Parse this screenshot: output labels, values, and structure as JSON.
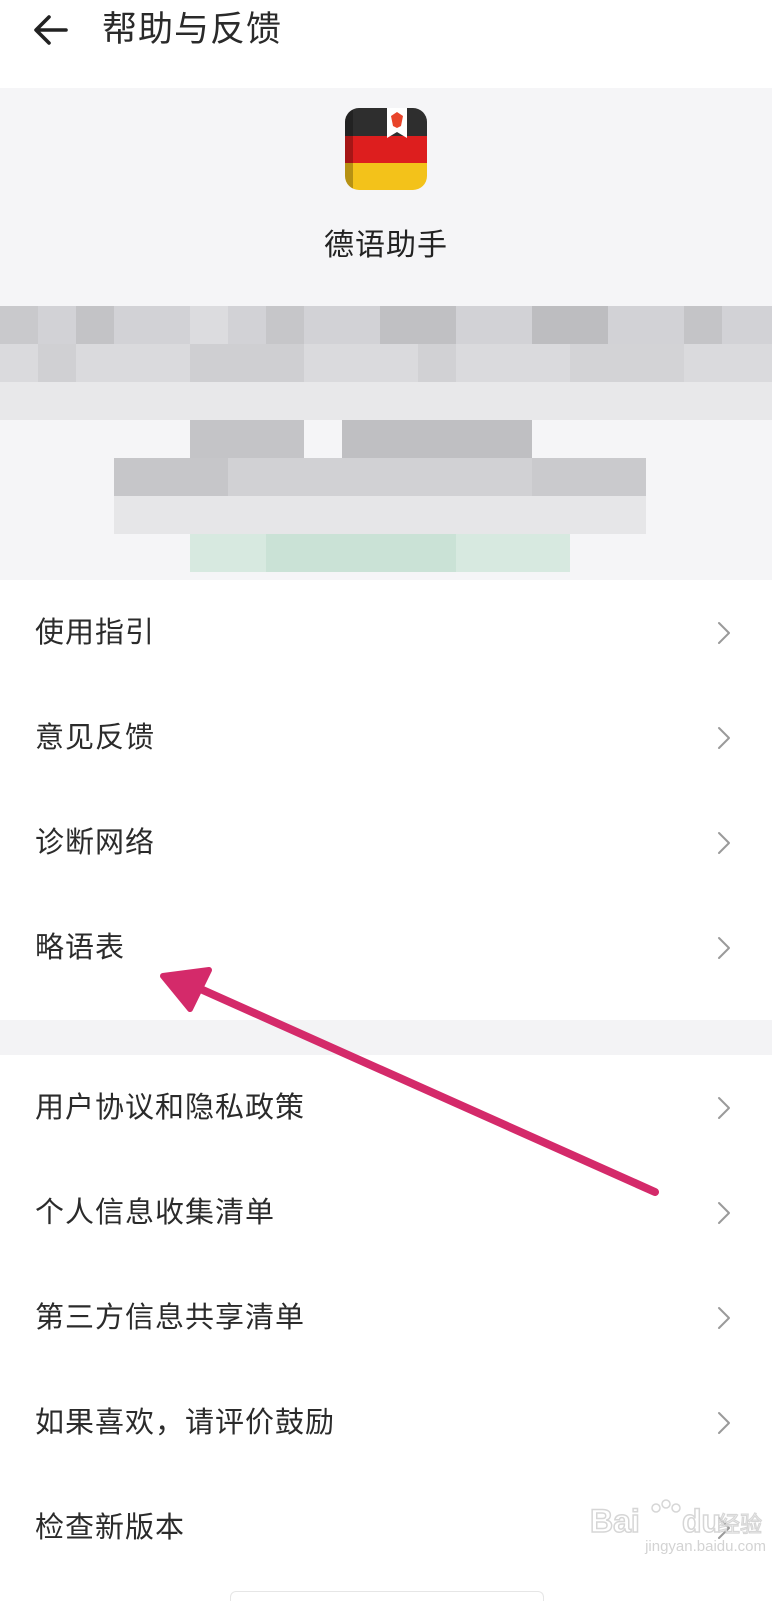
{
  "header": {
    "title": "帮助与反馈",
    "back_icon": "arrow-left-icon"
  },
  "app": {
    "name": "德语助手",
    "icon": "german-flag-book-icon",
    "colors": {
      "black": "#2a2a2a",
      "red": "#dd1e1e",
      "gold": "#f3c21a"
    }
  },
  "menu": {
    "group1": [
      {
        "label": "使用指引"
      },
      {
        "label": "意见反馈"
      },
      {
        "label": "诊断网络"
      },
      {
        "label": "略语表"
      }
    ],
    "group2": [
      {
        "label": "用户协议和隐私政策"
      },
      {
        "label": "个人信息收集清单"
      },
      {
        "label": "第三方信息共享清单"
      },
      {
        "label": "如果喜欢，请评价鼓励"
      },
      {
        "label": "检查新版本"
      }
    ],
    "chevron_icon": "chevron-right-icon"
  },
  "annotation": {
    "arrow_color": "#d42a6a",
    "arrow_icon": "pointer-arrow-icon"
  },
  "watermark": {
    "logo": "Bai du",
    "logo_cn": "经验",
    "url": "jingyan.baidu.com"
  }
}
